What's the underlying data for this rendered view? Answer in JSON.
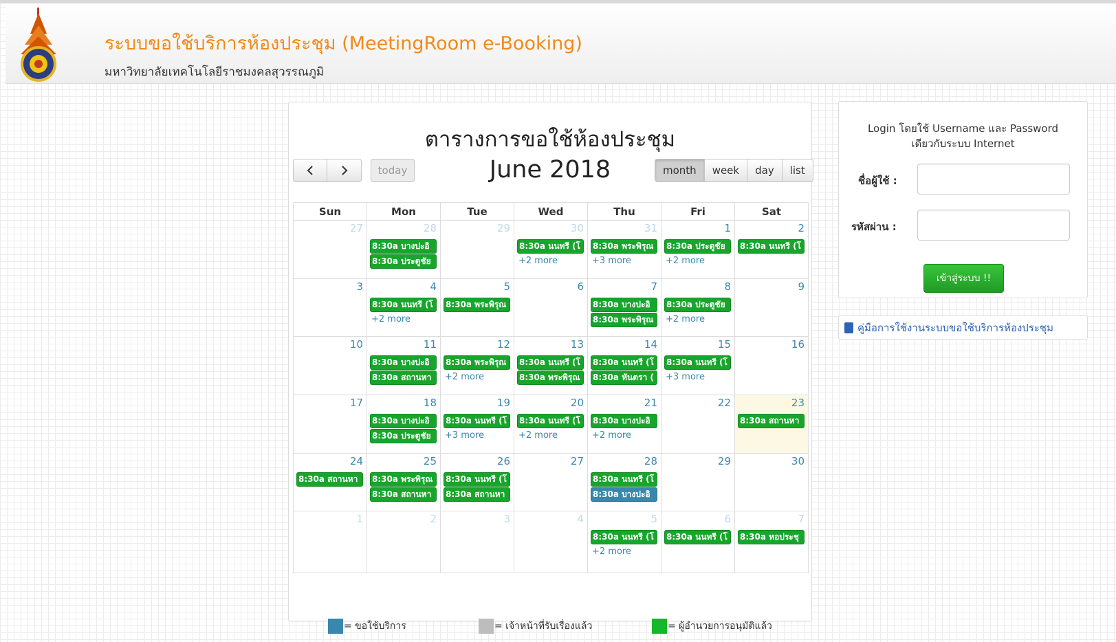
{
  "header": {
    "title": "ระบบขอใช้บริการห้องประชุม (MeetingRoom e-Booking)",
    "subtitle": "มหาวิทยาลัยเทคโนโลยีราชมงคลสุวรรณภูมิ"
  },
  "calendar": {
    "heading": "ตารางการขอใช้ห้องประชุม",
    "month_label": "June 2018",
    "nav": {
      "prev": "‹",
      "next": "›",
      "today": "today"
    },
    "views": [
      "month",
      "week",
      "day",
      "list"
    ],
    "active_view": "month",
    "dow": [
      "Sun",
      "Mon",
      "Tue",
      "Wed",
      "Thu",
      "Fri",
      "Sat"
    ],
    "weeks": [
      {
        "days": [
          {
            "num": "27",
            "other": true,
            "events": [],
            "more": ""
          },
          {
            "num": "28",
            "other": true,
            "events": [
              {
                "t": "8:30a บางปะอิ",
                "c": "green"
              },
              {
                "t": "8:30a ประตูชัย",
                "c": "green"
              }
            ],
            "more": ""
          },
          {
            "num": "29",
            "other": true,
            "events": [],
            "more": ""
          },
          {
            "num": "30",
            "other": true,
            "events": [
              {
                "t": "8:30a นนทรี (โ",
                "c": "green"
              }
            ],
            "more": "+2 more"
          },
          {
            "num": "31",
            "other": true,
            "events": [
              {
                "t": "8:30a พระพิรุณ",
                "c": "green"
              }
            ],
            "more": "+3 more"
          },
          {
            "num": "1",
            "other": false,
            "events": [
              {
                "t": "8:30a ประตูชัย",
                "c": "green"
              }
            ],
            "more": "+2 more"
          },
          {
            "num": "2",
            "other": false,
            "events": [
              {
                "t": "8:30a นนทรี (โ",
                "c": "green"
              }
            ],
            "more": ""
          }
        ]
      },
      {
        "days": [
          {
            "num": "3",
            "other": false,
            "events": [],
            "more": ""
          },
          {
            "num": "4",
            "other": false,
            "events": [
              {
                "t": "8:30a นนทรี (โ",
                "c": "green"
              }
            ],
            "more": "+2 more"
          },
          {
            "num": "5",
            "other": false,
            "events": [
              {
                "t": "8:30a พระพิรุณ",
                "c": "green"
              }
            ],
            "more": ""
          },
          {
            "num": "6",
            "other": false,
            "events": [],
            "more": ""
          },
          {
            "num": "7",
            "other": false,
            "events": [
              {
                "t": "8:30a บางปะอิ",
                "c": "green"
              },
              {
                "t": "8:30a พระพิรุณ",
                "c": "green"
              }
            ],
            "more": ""
          },
          {
            "num": "8",
            "other": false,
            "events": [
              {
                "t": "8:30a ประตูชัย",
                "c": "green"
              }
            ],
            "more": "+2 more"
          },
          {
            "num": "9",
            "other": false,
            "events": [],
            "more": ""
          }
        ]
      },
      {
        "days": [
          {
            "num": "10",
            "other": false,
            "events": [],
            "more": ""
          },
          {
            "num": "11",
            "other": false,
            "events": [
              {
                "t": "8:30a บางปะอิ",
                "c": "green"
              },
              {
                "t": "8:30a สถานหา",
                "c": "green"
              }
            ],
            "more": ""
          },
          {
            "num": "12",
            "other": false,
            "events": [
              {
                "t": "8:30a พระพิรุณ",
                "c": "green"
              }
            ],
            "more": "+2 more"
          },
          {
            "num": "13",
            "other": false,
            "events": [
              {
                "t": "8:30a นนทรี (โ",
                "c": "green"
              },
              {
                "t": "8:30a พระพิรุณ",
                "c": "green"
              }
            ],
            "more": ""
          },
          {
            "num": "14",
            "other": false,
            "events": [
              {
                "t": "8:30a นนทรี (โ",
                "c": "green"
              },
              {
                "t": "8:30a หันตรา (",
                "c": "green"
              }
            ],
            "more": ""
          },
          {
            "num": "15",
            "other": false,
            "events": [
              {
                "t": "8:30a นนทรี (โ",
                "c": "green"
              }
            ],
            "more": "+3 more"
          },
          {
            "num": "16",
            "other": false,
            "events": [],
            "more": ""
          }
        ]
      },
      {
        "days": [
          {
            "num": "17",
            "other": false,
            "events": [],
            "more": ""
          },
          {
            "num": "18",
            "other": false,
            "events": [
              {
                "t": "8:30a บางปะอิ",
                "c": "green"
              },
              {
                "t": "8:30a ประตูชัย",
                "c": "green"
              }
            ],
            "more": ""
          },
          {
            "num": "19",
            "other": false,
            "events": [
              {
                "t": "8:30a นนทรี (โ",
                "c": "green"
              }
            ],
            "more": "+3 more"
          },
          {
            "num": "20",
            "other": false,
            "events": [
              {
                "t": "8:30a นนทรี (โ",
                "c": "green"
              }
            ],
            "more": "+2 more"
          },
          {
            "num": "21",
            "other": false,
            "events": [
              {
                "t": "8:30a บางปะอิ",
                "c": "green"
              }
            ],
            "more": "+2 more"
          },
          {
            "num": "22",
            "other": false,
            "events": [],
            "more": ""
          },
          {
            "num": "23",
            "other": false,
            "today": true,
            "events": [
              {
                "t": "8:30a สถานหา",
                "c": "green"
              }
            ],
            "more": ""
          }
        ]
      },
      {
        "days": [
          {
            "num": "24",
            "other": false,
            "events": [
              {
                "t": "8:30a สถานหา",
                "c": "green"
              }
            ],
            "more": ""
          },
          {
            "num": "25",
            "other": false,
            "events": [
              {
                "t": "8:30a พระพิรุณ",
                "c": "green"
              },
              {
                "t": "8:30a สถานหา",
                "c": "green"
              }
            ],
            "more": ""
          },
          {
            "num": "26",
            "other": false,
            "events": [
              {
                "t": "8:30a นนทรี (โ",
                "c": "green"
              },
              {
                "t": "8:30a สถานหา",
                "c": "green"
              }
            ],
            "more": ""
          },
          {
            "num": "27",
            "other": false,
            "events": [],
            "more": ""
          },
          {
            "num": "28",
            "other": false,
            "events": [
              {
                "t": "8:30a นนทรี (โ",
                "c": "green"
              },
              {
                "t": "8:30a บางปะอิ",
                "c": "blue"
              }
            ],
            "more": ""
          },
          {
            "num": "29",
            "other": false,
            "events": [],
            "more": ""
          },
          {
            "num": "30",
            "other": false,
            "events": [],
            "more": ""
          }
        ]
      },
      {
        "days": [
          {
            "num": "1",
            "other": true,
            "events": [],
            "more": ""
          },
          {
            "num": "2",
            "other": true,
            "events": [],
            "more": ""
          },
          {
            "num": "3",
            "other": true,
            "events": [],
            "more": ""
          },
          {
            "num": "4",
            "other": true,
            "events": [],
            "more": ""
          },
          {
            "num": "5",
            "other": true,
            "events": [
              {
                "t": "8:30a นนทรี (โ",
                "c": "green"
              }
            ],
            "more": "+2 more"
          },
          {
            "num": "6",
            "other": true,
            "events": [
              {
                "t": "8:30a นนทรี (โ",
                "c": "green"
              }
            ],
            "more": ""
          },
          {
            "num": "7",
            "other": true,
            "events": [
              {
                "t": "8:30a หอประชุ",
                "c": "green"
              }
            ],
            "more": ""
          }
        ]
      }
    ],
    "legend": [
      {
        "color": "#3a87ad",
        "label": "= ขอใช้บริการ"
      },
      {
        "color": "#bdbdbd",
        "label": "= เจ้าหน้าที่รับเรื่องแล้ว"
      },
      {
        "color": "#14b82b",
        "label": "= ผู้อำนวยการอนุมัติแล้ว"
      }
    ]
  },
  "login": {
    "note_line1": "Login โดยใช้ Username และ Password",
    "note_line2": "เดียวกับระบบ Internet",
    "username_label": "ชื่อผู้ใช้ :",
    "password_label": "รหัสผ่าน :",
    "username_value": "",
    "password_value": "",
    "submit_label": "เข้าสู่ระบบ !!"
  },
  "manual": {
    "icon": "book-icon",
    "link_text": "คู่มือการใช้งานระบบขอใช้บริการห้องประชุม"
  },
  "colors": {
    "title": "#f08a1a",
    "event_green": "#18a52c",
    "event_blue": "#3a87ad",
    "link": "#2b63b6",
    "today_bg": "#fcf8e3"
  }
}
